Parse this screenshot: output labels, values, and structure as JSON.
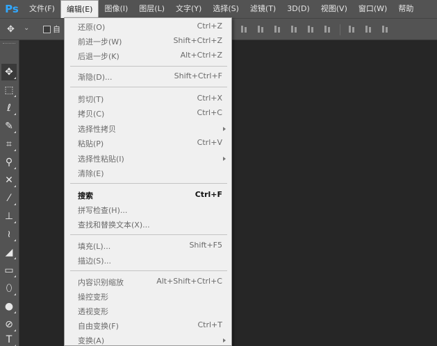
{
  "app_logo": "Ps",
  "menubar": {
    "items": [
      {
        "label": "文件(F)"
      },
      {
        "label": "编辑(E)"
      },
      {
        "label": "图像(I)"
      },
      {
        "label": "图层(L)"
      },
      {
        "label": "文字(Y)"
      },
      {
        "label": "选择(S)"
      },
      {
        "label": "滤镜(T)"
      },
      {
        "label": "3D(D)"
      },
      {
        "label": "视图(V)"
      },
      {
        "label": "窗口(W)"
      },
      {
        "label": "帮助"
      }
    ],
    "active_index": 1
  },
  "optionsbar": {
    "tool_icon": "move-icon",
    "auto_select_label": "自"
  },
  "toolbar": {
    "tools": [
      {
        "icon": "move-icon",
        "glyph": "✥"
      },
      {
        "icon": "marquee-icon",
        "glyph": "⬚"
      },
      {
        "icon": "lasso-icon",
        "glyph": "ℓ"
      },
      {
        "icon": "quick-select-icon",
        "glyph": "✎"
      },
      {
        "icon": "crop-icon",
        "glyph": "⌗"
      },
      {
        "icon": "eyedropper-icon",
        "glyph": "⚲"
      },
      {
        "icon": "healing-brush-icon",
        "glyph": "✕"
      },
      {
        "icon": "brush-icon",
        "glyph": "⁄"
      },
      {
        "icon": "clone-stamp-icon",
        "glyph": "⊥"
      },
      {
        "icon": "history-brush-icon",
        "glyph": "≀"
      },
      {
        "icon": "eraser-icon",
        "glyph": "◢"
      },
      {
        "icon": "gradient-icon",
        "glyph": "▭"
      },
      {
        "icon": "blur-icon",
        "glyph": "⬯"
      },
      {
        "icon": "dodge-icon",
        "glyph": "●"
      },
      {
        "icon": "pen-icon",
        "glyph": "⊘"
      },
      {
        "icon": "type-icon",
        "glyph": "T"
      }
    ]
  },
  "edit_menu": {
    "items": [
      {
        "label": "还原(O)",
        "shortcut": "Ctrl+Z"
      },
      {
        "label": "前进一步(W)",
        "shortcut": "Shift+Ctrl+Z"
      },
      {
        "label": "后退一步(K)",
        "shortcut": "Alt+Ctrl+Z"
      },
      {
        "label": "渐隐(D)...",
        "shortcut": "Shift+Ctrl+F"
      },
      {
        "label": "剪切(T)",
        "shortcut": "Ctrl+X"
      },
      {
        "label": "拷贝(C)",
        "shortcut": "Ctrl+C"
      },
      {
        "label": "选择性拷贝",
        "shortcut": ""
      },
      {
        "label": "粘贴(P)",
        "shortcut": "Ctrl+V"
      },
      {
        "label": "选择性粘贴(I)",
        "shortcut": ""
      },
      {
        "label": "清除(E)",
        "shortcut": ""
      },
      {
        "label": "搜索",
        "shortcut": "Ctrl+F"
      },
      {
        "label": "拼写检查(H)...",
        "shortcut": ""
      },
      {
        "label": "查找和替换文本(X)...",
        "shortcut": ""
      },
      {
        "label": "填充(L)...",
        "shortcut": "Shift+F5"
      },
      {
        "label": "描边(S)...",
        "shortcut": ""
      },
      {
        "label": "内容识别缩放",
        "shortcut": "Alt+Shift+Ctrl+C"
      },
      {
        "label": "操控变形",
        "shortcut": ""
      },
      {
        "label": "透视变形",
        "shortcut": ""
      },
      {
        "label": "自由变换(F)",
        "shortcut": "Ctrl+T"
      },
      {
        "label": "变换(A)",
        "shortcut": ""
      }
    ]
  },
  "colors": {
    "menubar_bg": "#535353",
    "menu_bg": "#f0f0f0",
    "canvas_bg": "#262626",
    "logo_blue": "#31a8ff"
  }
}
